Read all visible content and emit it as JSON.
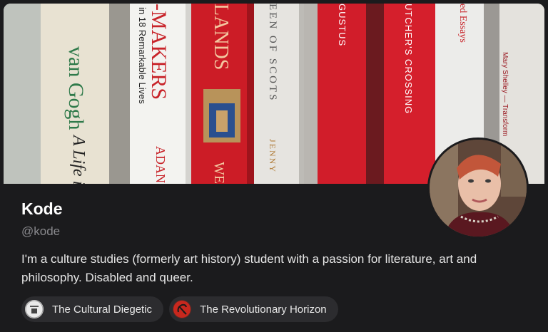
{
  "profile": {
    "name": "Kode",
    "handle": "@kode",
    "bio": "I'm a culture studies (formerly art history) student with a passion for literature, art and philosophy. Disabled and queer."
  },
  "banner": {
    "spines": [
      "van Gogh",
      "A Life in",
      "-MAKERS",
      "in 18 Remarkable Lives",
      "ADAN",
      "LANDS",
      "WE",
      "EEN OF SCOTS",
      "JENNY",
      "GUSTUS",
      "UTCHER'S CROSSING",
      "ed Essays",
      "Mary Shelley — Transform"
    ]
  },
  "publications": [
    {
      "label": "The Cultural Diegetic",
      "icon": "cultural-diegetic-logo-icon",
      "color": "#e9e9e9"
    },
    {
      "label": "The Revolutionary Horizon",
      "icon": "hammer-sickle-icon",
      "color": "#c8281e"
    }
  ]
}
